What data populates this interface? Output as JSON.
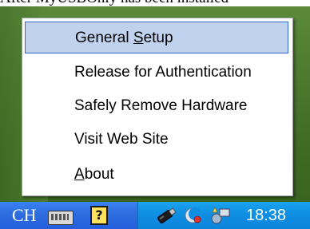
{
  "caption": "After MyUSBOnly has been installed",
  "context_menu": {
    "items": [
      {
        "label_pre": "General ",
        "label_mnemonic": "S",
        "label_post": "etup",
        "selected": true
      },
      {
        "label": "Release for Authentication"
      },
      {
        "label": "Safely Remove Hardware"
      },
      {
        "label": "Visit Web Site"
      },
      {
        "label_mnemonic": "A",
        "label_post": "bout"
      }
    ]
  },
  "taskbar": {
    "language": "CH",
    "keyboard_icon": "keyboard-icon",
    "help_icon_text": "?",
    "tray_icons": [
      "usb-drive-icon",
      "moon-icon",
      "network-icon"
    ],
    "clock": "18:38"
  },
  "colors": {
    "taskbar_blue": "#245edb",
    "tray_blue": "#0f8fe3",
    "menu_highlight": "#c1d2ee",
    "menu_highlight_border": "#316ac5"
  }
}
